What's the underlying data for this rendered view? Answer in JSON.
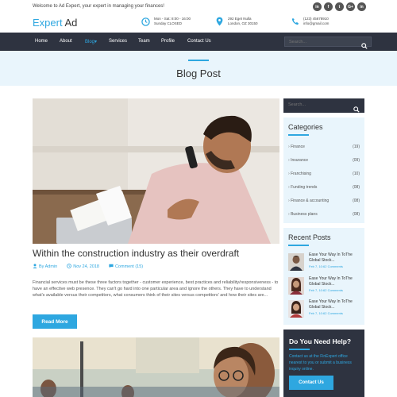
{
  "topbar": {
    "welcome": "Welcome to Ad Expert, your expert in managing your finances!",
    "socials": [
      "in",
      "f",
      "t",
      "G+",
      "in"
    ]
  },
  "brand": {
    "name_part1": "Expert",
    "name_part2": " Ad"
  },
  "contact": {
    "hours_line1": "Mon - Sat: 8:00 - 16:00",
    "hours_line2": "Sunday CLOSED",
    "address_line1": "292 Eget Nulla",
    "address_line2": "London, OZ 30150",
    "phone": "(123) 45678910",
    "email": "info@gmail.com"
  },
  "nav": {
    "items": [
      "Home",
      "About",
      "Blog",
      "Services",
      "Team",
      "Profile",
      "Contact Us"
    ],
    "blog_caret": "▾",
    "search_placeholder": "Search..."
  },
  "hero": {
    "title": "Blog Post"
  },
  "post": {
    "title": "Within the construction industry as their overdraft",
    "author": "By Admin",
    "date": "Nov 24, 2018",
    "comments": "Comment (15)",
    "excerpt": "Financial services must be these three factors together - customer experience, best practices and reliability/responsiveness - to have an effective web presence. They can't go hard into one particular area and ignore the others. They have to understand what's available versus their competitors, what consumers think of their sites versus competitors' and how their sites are...",
    "read_more": "Read More"
  },
  "sidebar": {
    "search_placeholder": "Search...",
    "categories_title": "Categories",
    "categories": [
      {
        "name": "Finance",
        "count": "(19)"
      },
      {
        "name": "Insurance",
        "count": "(09)"
      },
      {
        "name": "Franchising",
        "count": "(10)"
      },
      {
        "name": "Funding trends",
        "count": "(08)"
      },
      {
        "name": "Finance & accounting",
        "count": "(08)"
      },
      {
        "name": "Business plans",
        "count": "(08)"
      }
    ],
    "recent_title": "Recent Posts",
    "recent": [
      {
        "title": "Ease Your Way In ToThe Global Stock...",
        "date": "Feb 7, 10:62 Comments"
      },
      {
        "title": "Ease Your Way In ToThe Global Stock...",
        "date": "Feb 7, 10:62 Comments"
      },
      {
        "title": "Ease Your Way In ToThe Global Stock...",
        "date": "Feb 7, 10:62 Comments"
      }
    ],
    "help_title": "Do You Need Help?",
    "help_text": "Contact us at the FinExpert office nearest to you or submit a business inquiry online.",
    "help_button": "Contact Us"
  },
  "colors": {
    "accent": "#2ea7e0",
    "dark": "#2e3340",
    "hero_bg": "#e9f5fc"
  }
}
